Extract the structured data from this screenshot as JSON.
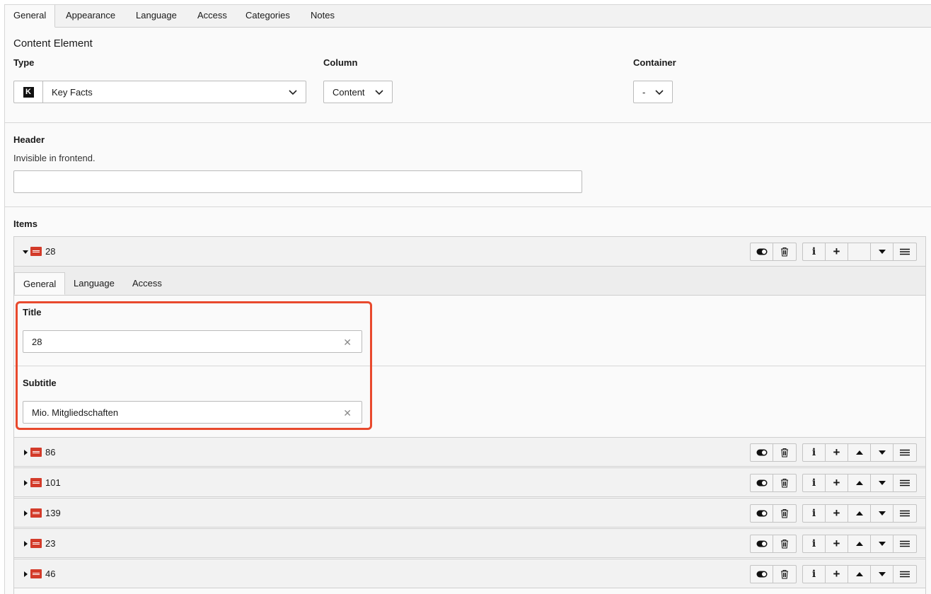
{
  "tabs": [
    "General",
    "Appearance",
    "Language",
    "Access",
    "Categories",
    "Notes"
  ],
  "content_element": {
    "section_title": "Content Element",
    "type_label": "Type",
    "type_icon_letter": "K",
    "type_value": "Key Facts",
    "column_label": "Column",
    "column_value": "Content",
    "container_label": "Container",
    "container_value": "-"
  },
  "header": {
    "label": "Header",
    "hint": "Invisible in frontend.",
    "value": ""
  },
  "items": {
    "label": "Items",
    "expanded": {
      "title": "28",
      "tabs": [
        "General",
        "Language",
        "Access"
      ],
      "title_label": "Title",
      "title_value": "28",
      "subtitle_label": "Subtitle",
      "subtitle_value": "Mio. Mitgliedschaften"
    },
    "collapsed": [
      "86",
      "101",
      "139",
      "23",
      "46"
    ]
  },
  "colors": {
    "highlight": "#e8492d",
    "item_icon": "#d33b2a"
  }
}
